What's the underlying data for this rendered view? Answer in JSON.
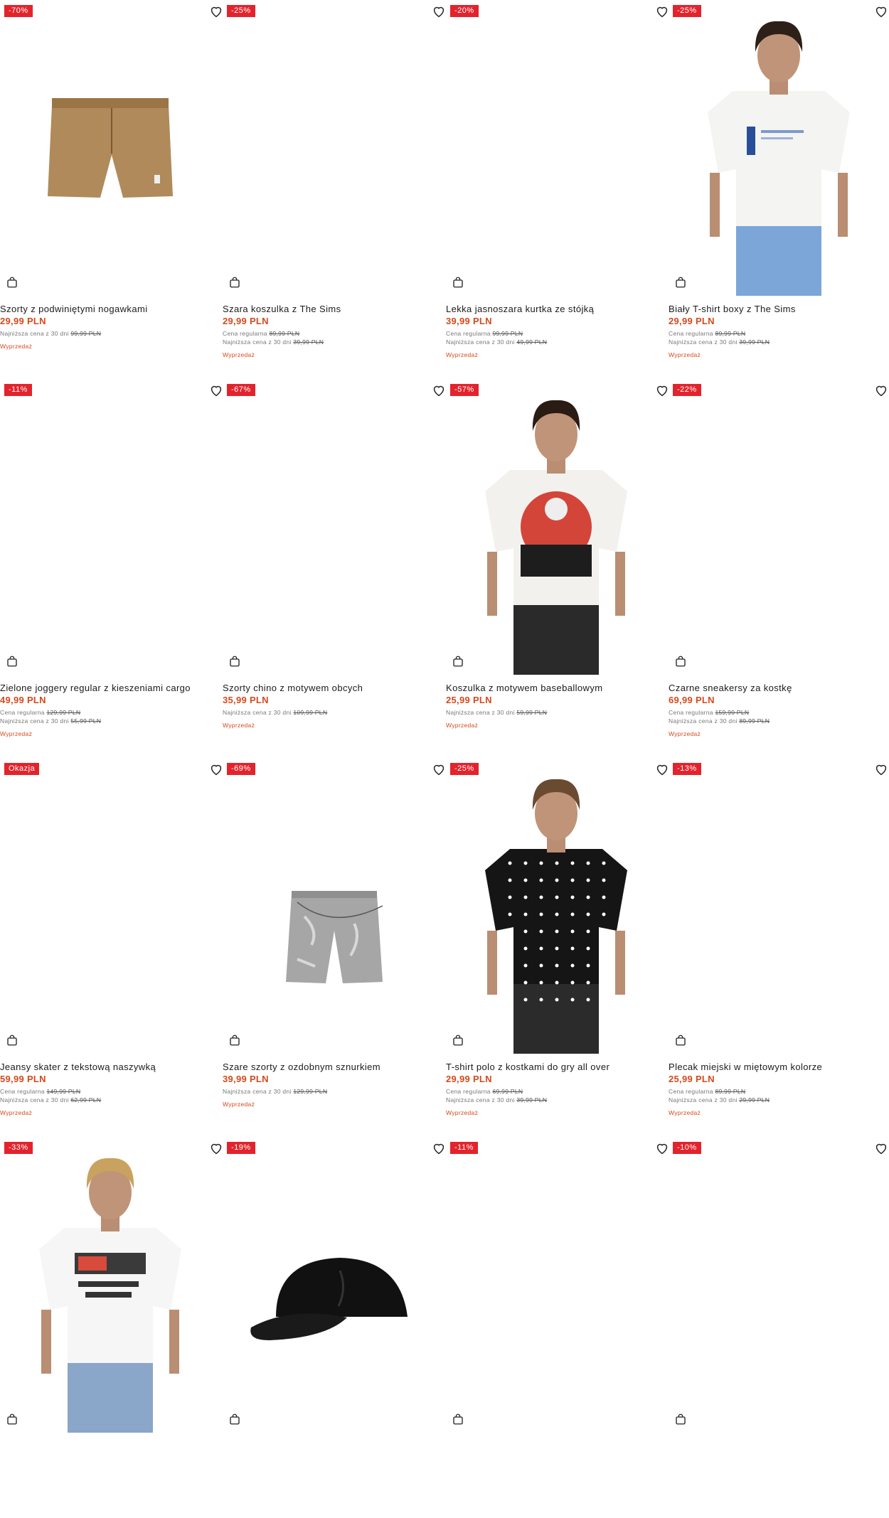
{
  "colors": {
    "badge": "#e3232c",
    "price": "#d44a1c"
  },
  "icons": {
    "wishlist": "heart-icon",
    "cart": "shopping-bag-icon"
  },
  "products": [
    {
      "badge": "-70%",
      "title": "Szorty z podwiniętymi nogawkami",
      "price": "29,99 PLN",
      "regular_label": "",
      "regular_price": "",
      "lowest_label": "Najniższa cena z 30 dni",
      "lowest_price": "99,99 PLN",
      "sale": "Wyprzedaż",
      "image": "khaki-shorts"
    },
    {
      "badge": "-25%",
      "title": "Szara koszulka z The Sims",
      "price": "29,99 PLN",
      "regular_label": "Cena regularna",
      "regular_price": "89,99 PLN",
      "lowest_label": "Najniższa cena z 30 dni",
      "lowest_price": "39,99 PLN",
      "sale": "Wyprzedaż",
      "image": ""
    },
    {
      "badge": "-20%",
      "title": "Lekka jasnoszara kurtka ze stójką",
      "price": "39,99 PLN",
      "regular_label": "Cena regularna",
      "regular_price": "99,99 PLN",
      "lowest_label": "Najniższa cena z 30 dni",
      "lowest_price": "49,99 PLN",
      "sale": "Wyprzedaż",
      "image": ""
    },
    {
      "badge": "-25%",
      "title": "Biały T-shirt boxy z The Sims",
      "price": "29,99 PLN",
      "regular_label": "Cena regularna",
      "regular_price": "89,99 PLN",
      "lowest_label": "Najniższa cena z 30 dni",
      "lowest_price": "39,99 PLN",
      "sale": "Wyprzedaż",
      "image": "model-white-tee"
    },
    {
      "badge": "-11%",
      "title": "Zielone joggery regular z kieszeniami cargo",
      "price": "49,99 PLN",
      "regular_label": "Cena regularna",
      "regular_price": "129,99 PLN",
      "lowest_label": "Najniższa cena z 30 dni",
      "lowest_price": "55,99 PLN",
      "sale": "Wyprzedaż",
      "image": ""
    },
    {
      "badge": "-67%",
      "title": "Szorty chino z motywem obcych",
      "price": "35,99 PLN",
      "regular_label": "",
      "regular_price": "",
      "lowest_label": "Najniższa cena z 30 dni",
      "lowest_price": "109,99 PLN",
      "sale": "Wyprzedaż",
      "image": ""
    },
    {
      "badge": "-57%",
      "title": "Koszulka z motywem baseballowym",
      "price": "25,99 PLN",
      "regular_label": "",
      "regular_price": "",
      "lowest_label": "Najniższa cena z 30 dni",
      "lowest_price": "59,99 PLN",
      "sale": "Wyprzedaż",
      "image": "model-graphic-tee"
    },
    {
      "badge": "-22%",
      "title": "Czarne sneakersy za kostkę",
      "price": "69,99 PLN",
      "regular_label": "Cena regularna",
      "regular_price": "159,99 PLN",
      "lowest_label": "Najniższa cena z 30 dni",
      "lowest_price": "89,99 PLN",
      "sale": "Wyprzedaż",
      "image": ""
    },
    {
      "badge": "Okazja",
      "title": "Jeansy skater z tekstową naszywką",
      "price": "59,99 PLN",
      "regular_label": "Cena regularna",
      "regular_price": "149,99 PLN",
      "lowest_label": "Najniższa cena z 30 dni",
      "lowest_price": "62,99 PLN",
      "sale": "Wyprzedaż",
      "image": ""
    },
    {
      "badge": "-69%",
      "title": "Szare szorty z ozdobnym sznurkiem",
      "price": "39,99 PLN",
      "regular_label": "",
      "regular_price": "",
      "lowest_label": "Najniższa cena z 30 dni",
      "lowest_price": "129,99 PLN",
      "sale": "Wyprzedaż",
      "image": "denim-shorts"
    },
    {
      "badge": "-25%",
      "title": "T-shirt polo z kostkami do gry all over",
      "price": "29,99 PLN",
      "regular_label": "Cena regularna",
      "regular_price": "69,99 PLN",
      "lowest_label": "Najniższa cena z 30 dni",
      "lowest_price": "39,99 PLN",
      "sale": "Wyprzedaż",
      "image": "model-polo"
    },
    {
      "badge": "-13%",
      "title": "Plecak miejski w miętowym kolorze",
      "price": "25,99 PLN",
      "regular_label": "Cena regularna",
      "regular_price": "89,99 PLN",
      "lowest_label": "Najniższa cena z 30 dni",
      "lowest_price": "29,99 PLN",
      "sale": "Wyprzedaż",
      "image": ""
    },
    {
      "badge": "-33%",
      "title": "",
      "price": "",
      "regular_label": "",
      "regular_price": "",
      "lowest_label": "",
      "lowest_price": "",
      "sale": "",
      "image": "model-metallica-tee"
    },
    {
      "badge": "-19%",
      "title": "",
      "price": "",
      "regular_label": "",
      "regular_price": "",
      "lowest_label": "",
      "lowest_price": "",
      "sale": "",
      "image": "black-cap"
    },
    {
      "badge": "-11%",
      "title": "",
      "price": "",
      "regular_label": "",
      "regular_price": "",
      "lowest_label": "",
      "lowest_price": "",
      "sale": "",
      "image": ""
    },
    {
      "badge": "-10%",
      "title": "",
      "price": "",
      "regular_label": "",
      "regular_price": "",
      "lowest_label": "",
      "lowest_price": "",
      "sale": "",
      "image": ""
    }
  ]
}
